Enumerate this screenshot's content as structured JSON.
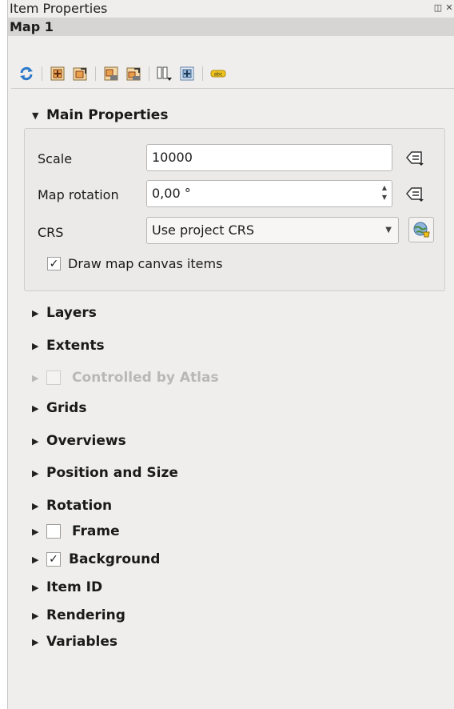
{
  "dock": {
    "title": "Item Properties",
    "float_glyph": "◫",
    "close_glyph": "✕"
  },
  "item": {
    "name": "Map 1"
  },
  "toolbar": {
    "icons": [
      "refresh-icon",
      "set-extent-to-canvas-icon",
      "view-extent-in-canvas-icon",
      "set-scale-to-canvas-icon",
      "view-scale-in-canvas-icon",
      "bookmarks-icon",
      "set-to-atlas-icon",
      "label-settings-icon"
    ]
  },
  "main": {
    "title": "Main Properties",
    "scale_label": "Scale",
    "scale_value": "10000",
    "rotation_label": "Map rotation",
    "rotation_value": "0,00 °",
    "crs_label": "CRS",
    "crs_value": "Use project CRS",
    "draw_label": "Draw map canvas items",
    "draw_checked": "✓"
  },
  "sections": {
    "layers": "Layers",
    "extents": "Extents",
    "atlas": "Controlled by Atlas",
    "grids": "Grids",
    "overviews": "Overviews",
    "position": "Position and Size",
    "rotation": "Rotation",
    "frame": "Frame",
    "background": "Background",
    "background_checked": "✓",
    "item_id": "Item ID",
    "rendering": "Rendering",
    "variables": "Variables"
  },
  "glyphs": {
    "expanded": "▼",
    "collapsed": "▶",
    "spin_up": "▲",
    "spin_down": "▼",
    "combo": "▼"
  },
  "colors": {
    "panel_bg": "#efeeec",
    "header_bg": "#d6d5d3",
    "accent_blue": "#2b78c8"
  }
}
